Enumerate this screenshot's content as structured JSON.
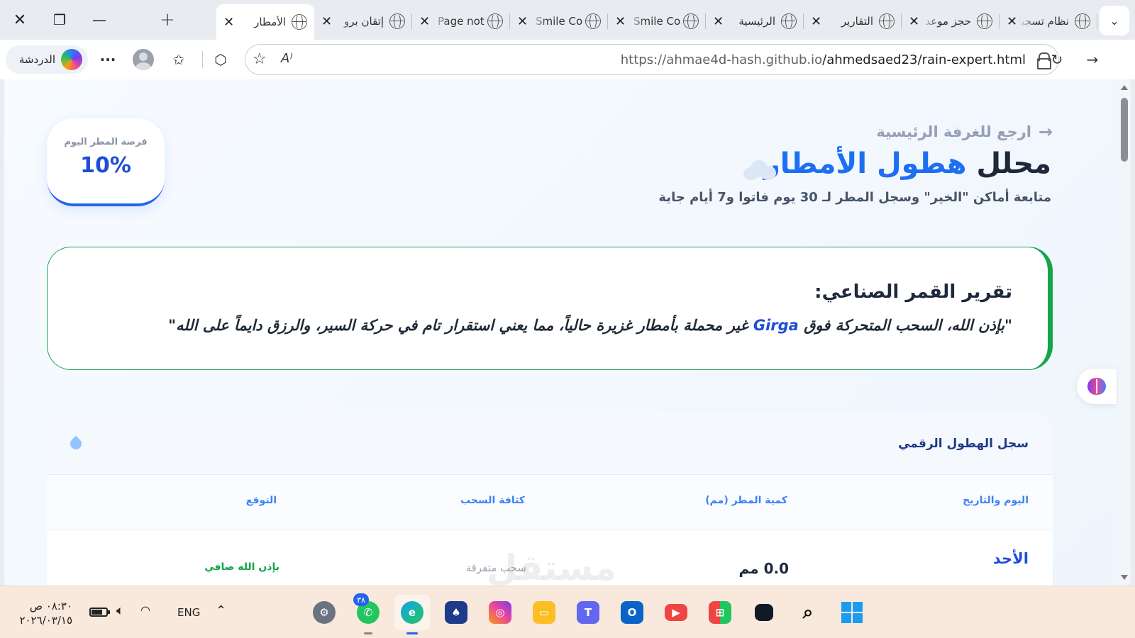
{
  "window": {
    "close": "✕",
    "restore": "❐",
    "minimize": "—"
  },
  "tabstrip": {
    "new_tab": "+",
    "tab_list": "⌄",
    "tabs": [
      {
        "title": "الأمطار",
        "active": true
      },
      {
        "title": "إتقان برو",
        "active": false
      },
      {
        "title": "Page not",
        "active": false
      },
      {
        "title": "Smile Co",
        "active": false
      },
      {
        "title": "Smile Co",
        "active": false
      },
      {
        "title": "الرئيسية",
        "active": false
      },
      {
        "title": "التقارير",
        "active": false
      },
      {
        "title": "حجز موعد",
        "active": false
      },
      {
        "title": "نظام تسجيل",
        "active": false
      }
    ]
  },
  "toolbar": {
    "chat_label": "الدردشة",
    "more": "···",
    "url_host": "https://ahmae4d-hash.github.io",
    "url_path": "/ahmedsaed23/rain-expert.html",
    "read_aloud": "A⁾"
  },
  "page": {
    "rain_chance_label": "فرصة المطر اليوم",
    "rain_chance_value": "10%",
    "back_link": "ارجع للغرفة الرئيسية",
    "title_part1": "محلل",
    "title_part2": "هطول الأمطار",
    "subtitle": "متابعة أماكن \"الخير\" وسجل المطر لـ 30 يوم فاتوا و7 أيام جاية",
    "satellite_title": "تقرير القمر الصناعي:",
    "satellite_quote_before": "\"بإذن الله، السحب المتحركة فوق ",
    "satellite_city": "Girga",
    "satellite_quote_after": " غير محملة بأمطار غزيرة حالياً، مما يعني استقرار تام في حركة السير، والرزق دايماً على الله\"",
    "log_title": "سجل الهطول الرقمي",
    "columns": [
      "اليوم والتاريخ",
      "كمية المطر (مم)",
      "كثافة السحب",
      "التوقع"
    ],
    "rows": [
      {
        "day": "الأحد",
        "amount": "0.0 مم",
        "density": "سحب متفرقة",
        "forecast": "بإذن الله صافي"
      }
    ],
    "watermark": "مستقل"
  },
  "taskbar": {
    "time": "٠٨:٣٠ ص",
    "date": "٢٠٢٦/٠٣/١٥",
    "lang": "ENG",
    "whatsapp_badge": "٣٨",
    "apps": [
      "settings",
      "whatsapp",
      "edge",
      "solitaire",
      "instagram",
      "file-explorer",
      "teams",
      "outlook",
      "youtube",
      "microsoft-store",
      "terminal",
      "search",
      "start"
    ]
  },
  "colors": {
    "accent": "#1d6ff2",
    "success": "#16a34a",
    "taskbar": "#f8e9dc"
  }
}
